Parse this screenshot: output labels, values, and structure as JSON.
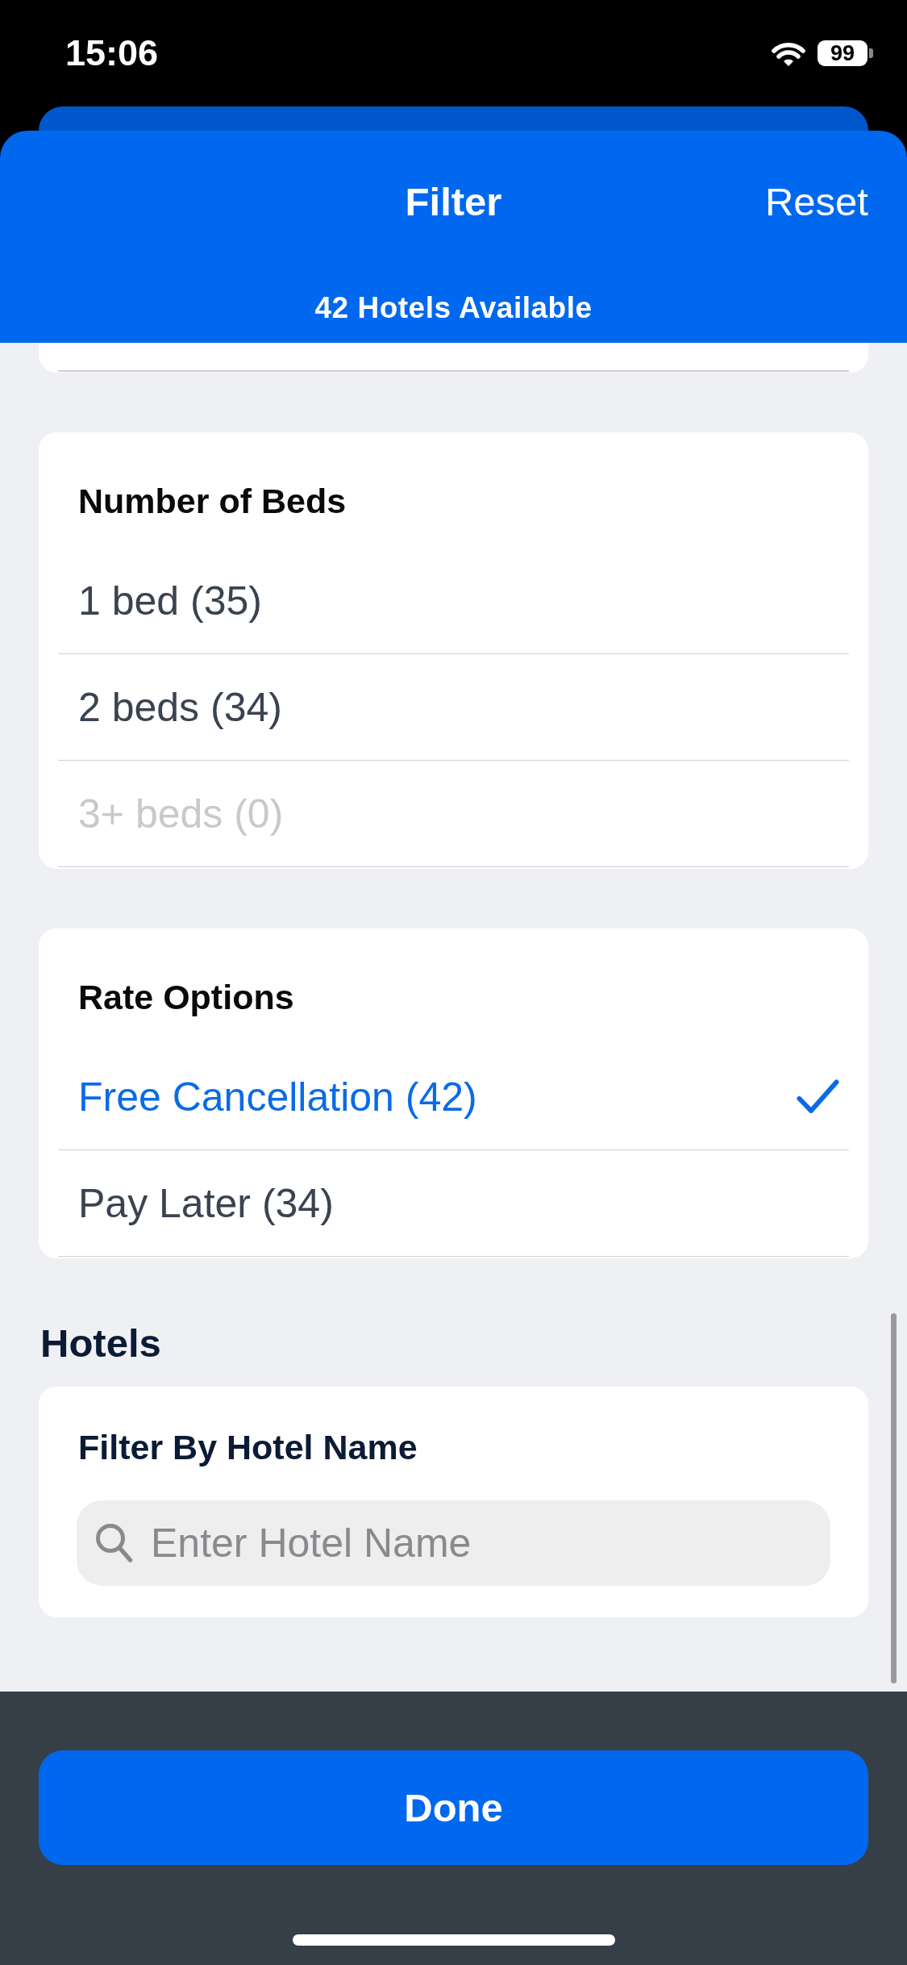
{
  "status_bar": {
    "time": "15:06",
    "battery": "99"
  },
  "header": {
    "title": "Filter",
    "reset": "Reset",
    "subtitle": "42 Hotels Available"
  },
  "sections": [
    {
      "title": "Number of Beds",
      "options": [
        {
          "label": "1 bed (35)",
          "selected": false,
          "disabled": false
        },
        {
          "label": "2 beds (34)",
          "selected": false,
          "disabled": false
        },
        {
          "label": "3+ beds (0)",
          "selected": false,
          "disabled": true
        }
      ]
    },
    {
      "title": "Rate Options",
      "options": [
        {
          "label": "Free Cancellation (42)",
          "selected": true,
          "disabled": false
        },
        {
          "label": "Pay Later (34)",
          "selected": false,
          "disabled": false
        }
      ]
    }
  ],
  "hotels": {
    "heading": "Hotels",
    "label": "Filter By Hotel Name",
    "search": {
      "placeholder": "Enter Hotel Name"
    }
  },
  "done_button": "Done"
}
